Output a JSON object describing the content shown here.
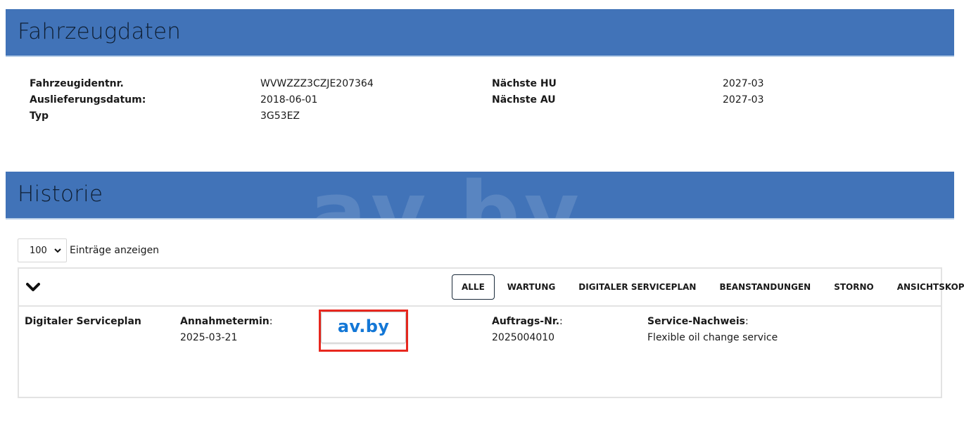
{
  "vehicle_section": {
    "title": "Fahrzeugdaten"
  },
  "vehicle": {
    "left": [
      {
        "label": "Fahrzeugidentnr.",
        "value": "WVWZZZ3CZJE207364"
      },
      {
        "label": "Auslieferungsdatum:",
        "value": "2018-06-01"
      },
      {
        "label": "Typ",
        "value": "3G53EZ"
      }
    ],
    "right": [
      {
        "label": "Nächste HU",
        "value": "2027-03"
      },
      {
        "label": "Nächste AU",
        "value": "2027-03"
      }
    ]
  },
  "history_section": {
    "title": "Historie",
    "watermark": "av.by"
  },
  "entries": {
    "selected": "100",
    "label": "Einträge anzeigen"
  },
  "filters": {
    "tabs": [
      "ALLE",
      "WARTUNG",
      "DIGITALER SERVICEPLAN",
      "BEANSTANDUNGEN",
      "STORNO",
      "ANSICHTSKOPIE"
    ],
    "active": "ALLE"
  },
  "history_entry": {
    "type": "Digitaler Serviceplan",
    "annahmetermin_label": "Annahmetermin",
    "annahmetermin_value": "2025-03-21",
    "logo_text": "av.by",
    "auftrag_label": "Auftrags-Nr.",
    "auftrag_value": "2025004010",
    "nachweis_label": "Service-Nachweis",
    "nachweis_value": "Flexible oil change service"
  },
  "colors": {
    "header_bg": "#4173b8",
    "highlight_border": "#e8281f",
    "logo_blue": "#1377d6"
  },
  "icons": {
    "collapse": "chevron-down-icon",
    "select_arrow": "chevron-down-icon"
  }
}
